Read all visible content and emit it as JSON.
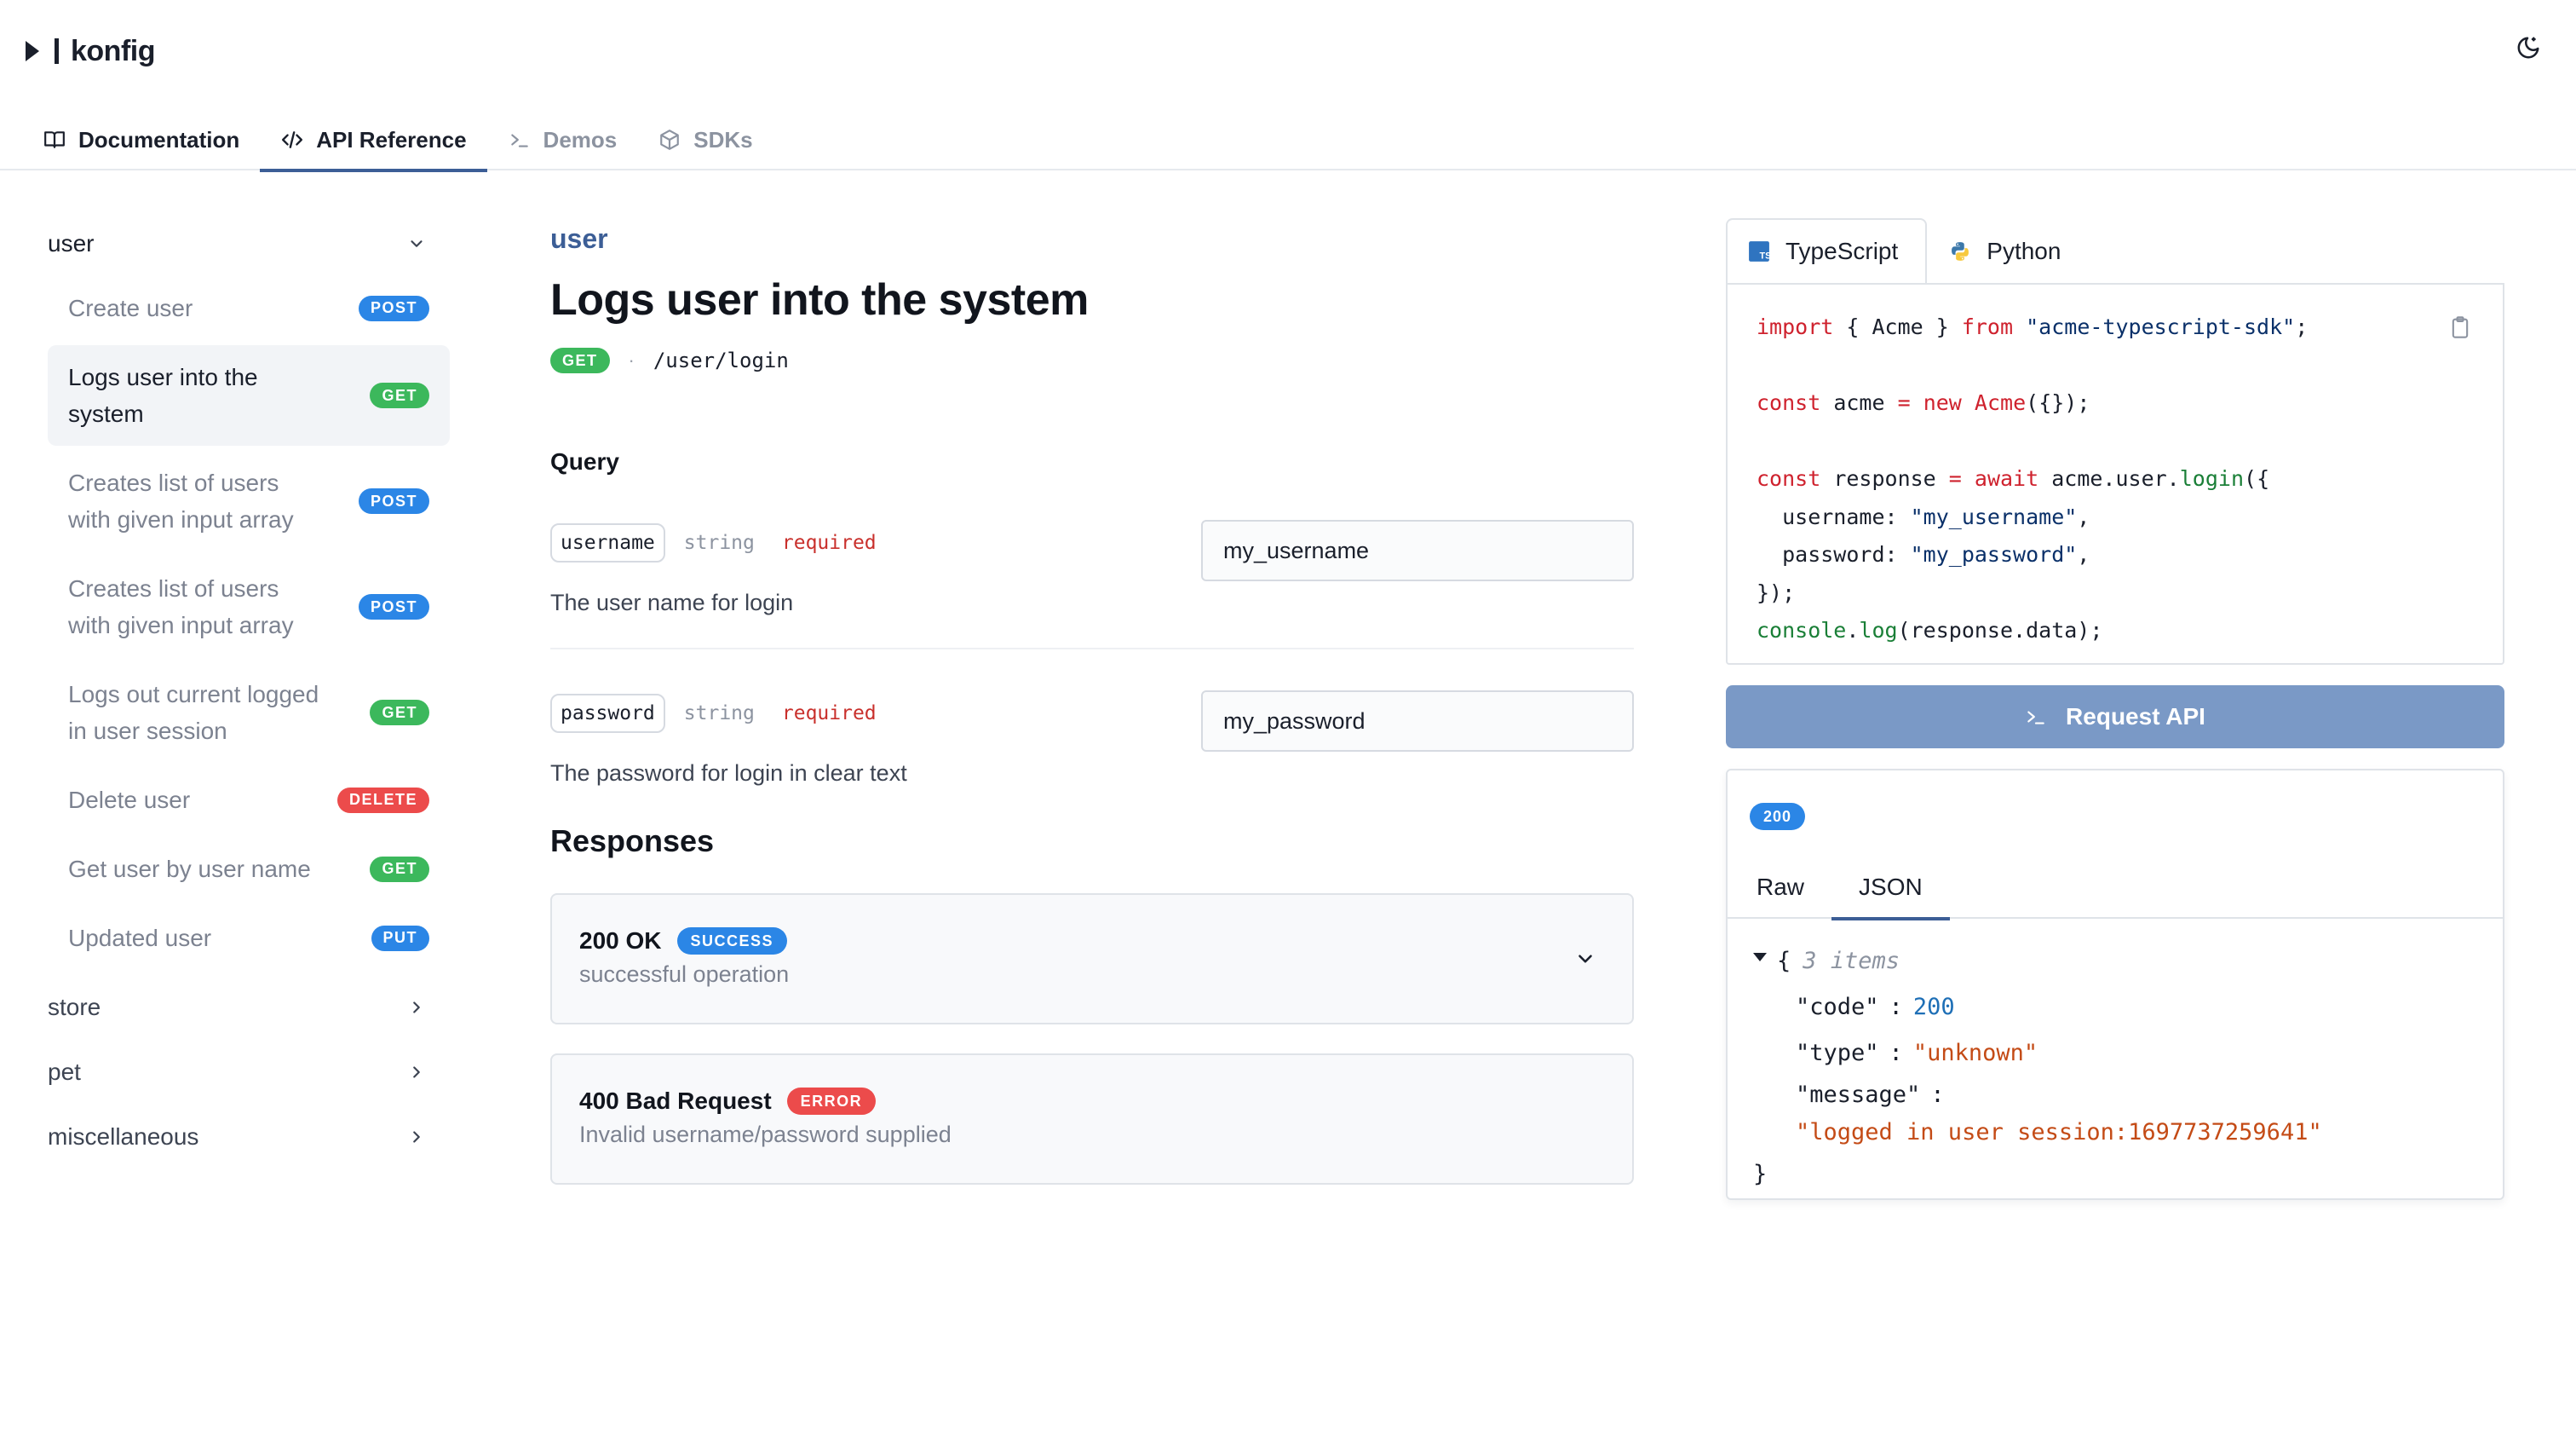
{
  "brand": {
    "name": "konfig"
  },
  "nav": {
    "tabs": [
      {
        "label": "Documentation",
        "icon": "book-icon"
      },
      {
        "label": "API Reference",
        "icon": "code-icon"
      },
      {
        "label": "Demos",
        "icon": "terminal-icon"
      },
      {
        "label": "SDKs",
        "icon": "cube-icon"
      }
    ]
  },
  "sidebar": {
    "groups": [
      {
        "label": "user",
        "expanded": true
      },
      {
        "label": "store"
      },
      {
        "label": "pet"
      },
      {
        "label": "miscellaneous"
      }
    ],
    "items": [
      {
        "label": "Create user",
        "method": "POST"
      },
      {
        "label": "Logs user into the system",
        "method": "GET"
      },
      {
        "label": "Creates list of users with given input array",
        "method": "POST"
      },
      {
        "label": "Creates list of users with given input array",
        "method": "POST"
      },
      {
        "label": "Logs out current logged in user session",
        "method": "GET"
      },
      {
        "label": "Delete user",
        "method": "DELETE"
      },
      {
        "label": "Get user by user name",
        "method": "GET"
      },
      {
        "label": "Updated user",
        "method": "PUT"
      }
    ]
  },
  "main": {
    "breadcrumb": "user",
    "title": "Logs user into the system",
    "method": "GET",
    "separator": "·",
    "path": "/user/login",
    "query_heading": "Query",
    "params": [
      {
        "name": "username",
        "type": "string",
        "required": "required",
        "description": "The user name for login",
        "value": "my_username"
      },
      {
        "name": "password",
        "type": "string",
        "required": "required",
        "description": "The password for login in clear text",
        "value": "my_password"
      }
    ],
    "responses_heading": "Responses",
    "responses": [
      {
        "status": "200 OK",
        "badge": "SUCCESS",
        "description": "successful operation"
      },
      {
        "status": "400 Bad Request",
        "badge": "ERROR",
        "description": "Invalid username/password supplied"
      }
    ]
  },
  "code": {
    "tabs": [
      {
        "label": "TypeScript",
        "icon": "typescript-icon"
      },
      {
        "label": "Python",
        "icon": "python-icon"
      }
    ],
    "lines": {
      "l1_kw": "import",
      "l1_a": " { Acme } ",
      "l1_kw2": "from",
      "l1_sp": " ",
      "l1_str": "\"acme-typescript-sdk\"",
      "l1_end": ";",
      "l3_kw": "const",
      "l3_a": " acme ",
      "l3_op": "=",
      "l3_sp": " ",
      "l3_kw2": "new",
      "l3_sp2": " ",
      "l3_fn": "Acme",
      "l3_end": "({});",
      "l5_kw": "const",
      "l5_a": " response ",
      "l5_op": "=",
      "l5_sp": " ",
      "l5_kw2": "await",
      "l5_b": " acme.user.",
      "l5_fn": "login",
      "l5_end": "({",
      "l6_a": "  username: ",
      "l6_str": "\"my_username\"",
      "l6_end": ",",
      "l7_a": "  password: ",
      "l7_str": "\"my_password\"",
      "l7_end": ",",
      "l8": "});",
      "l9_fn": "console",
      "l9_a": ".",
      "l9_fn2": "log",
      "l9_end": "(response.data);"
    },
    "request_label": "Request API"
  },
  "response": {
    "status": "200",
    "tabs": [
      "Raw",
      "JSON"
    ],
    "json": {
      "open": "{",
      "meta": "3 items",
      "code_key": "\"code\"",
      "code_val": "200",
      "type_key": "\"type\"",
      "type_val": "\"unknown\"",
      "message_key": "\"message\"",
      "message_val": "\"logged in user session:1697737259641\"",
      "close": "}",
      "colon": ":"
    }
  }
}
